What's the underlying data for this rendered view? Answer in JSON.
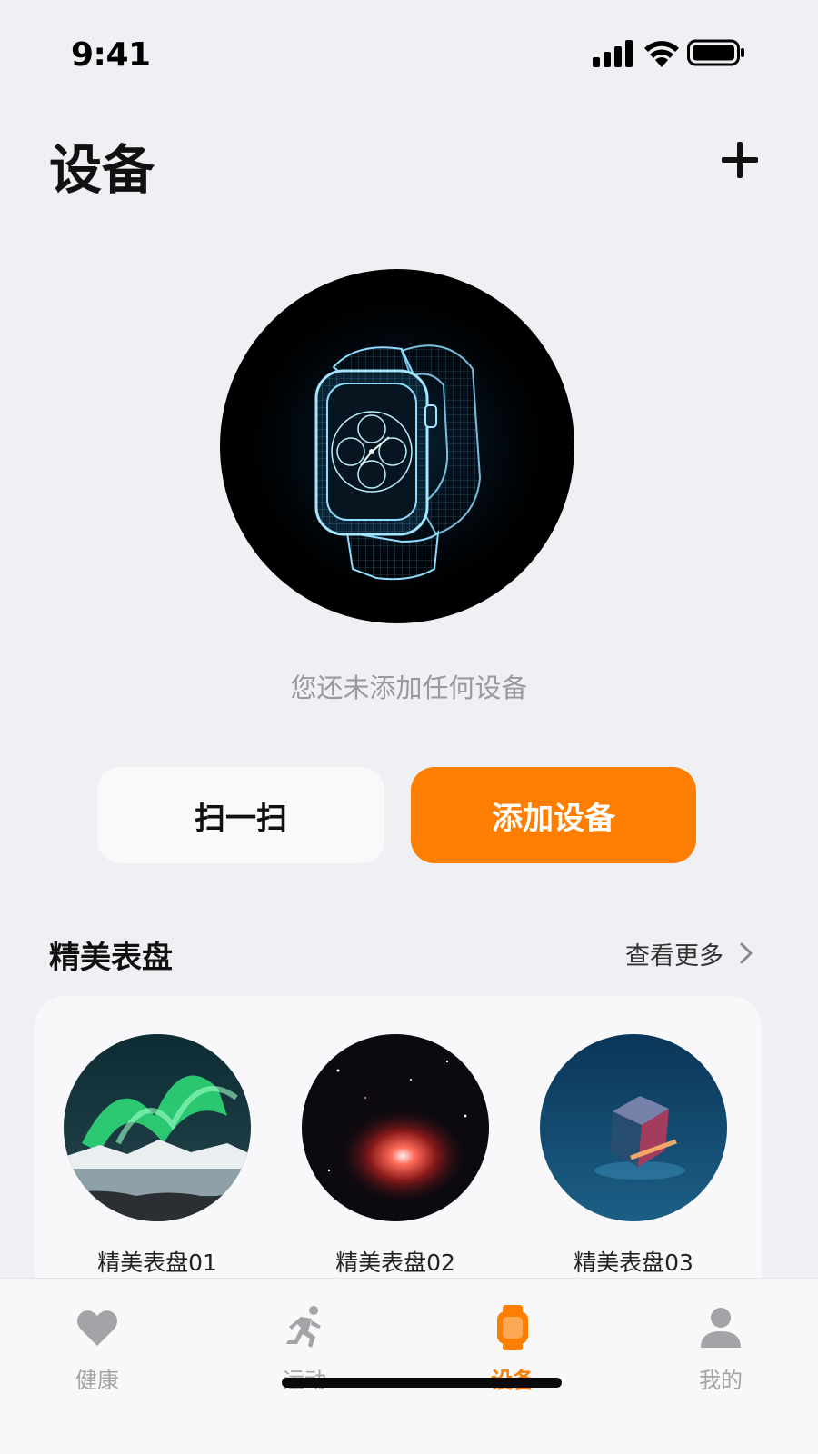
{
  "status_bar": {
    "time": "9:41",
    "icons": [
      "signal-icon",
      "wifi-icon",
      "battery-icon"
    ]
  },
  "header": {
    "title": "设备",
    "add_icon": "plus-icon"
  },
  "hero": {
    "image": "smartwatch-wireframe",
    "empty_message": "您还未添加任何设备"
  },
  "actions": {
    "scan_label": "扫一扫",
    "add_device_label": "添加设备"
  },
  "watch_faces": {
    "section_title": "精美表盘",
    "see_more_label": "查看更多",
    "items": [
      {
        "label": "精美表盘01",
        "image": "aurora-landscape"
      },
      {
        "label": "精美表盘02",
        "image": "red-nebula"
      },
      {
        "label": "精美表盘03",
        "image": "glowing-cube"
      }
    ]
  },
  "tabs": [
    {
      "label": "健康",
      "icon": "heart-icon",
      "active": false
    },
    {
      "label": "运动",
      "icon": "running-icon",
      "active": false
    },
    {
      "label": "设备",
      "icon": "watch-icon",
      "active": true
    },
    {
      "label": "我的",
      "icon": "person-icon",
      "active": false
    }
  ],
  "colors": {
    "accent": "#fd7e01",
    "background": "#eff0f4",
    "inactive_tab": "#a3a3a8",
    "secondary_text": "#999aa0"
  }
}
